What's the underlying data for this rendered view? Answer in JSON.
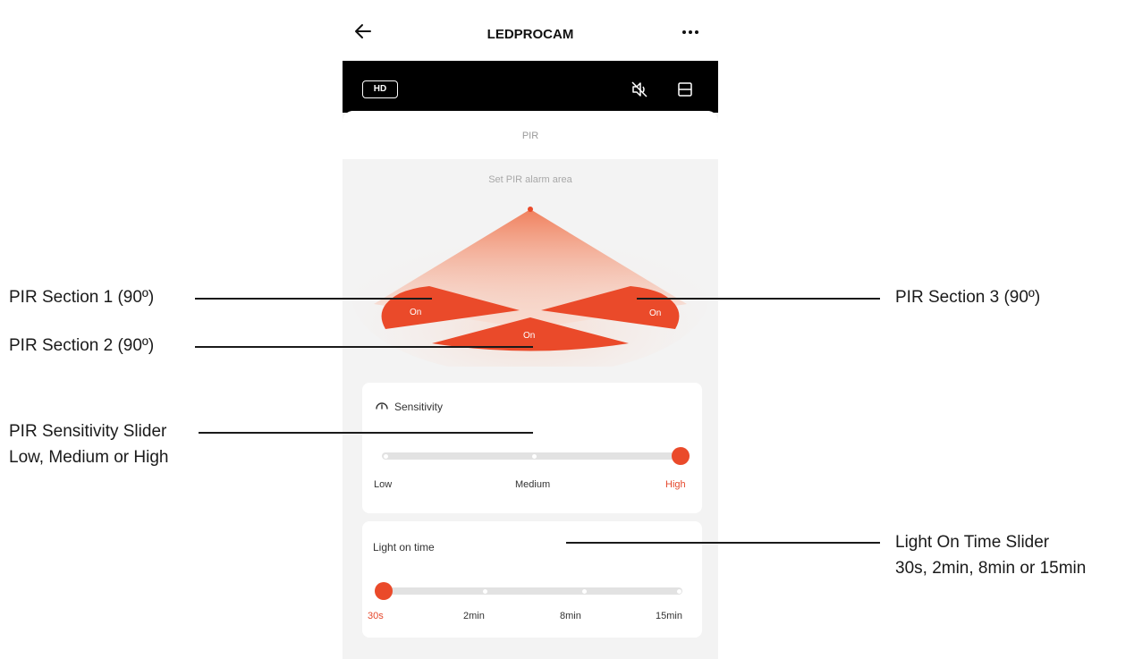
{
  "app": {
    "title": "LEDPROCAM",
    "hd_label": "HD"
  },
  "panel": {
    "title": "PIR",
    "subtitle": "Set PIR alarm area"
  },
  "pir_sections": [
    {
      "label": "On",
      "state": "on"
    },
    {
      "label": "On",
      "state": "on"
    },
    {
      "label": "On",
      "state": "on"
    }
  ],
  "sensitivity": {
    "title": "Sensitivity",
    "options": [
      "Low",
      "Medium",
      "High"
    ],
    "selected": "High"
  },
  "light_on_time": {
    "title": "Light on time",
    "options": [
      "30s",
      "2min",
      "8min",
      "15min"
    ],
    "selected": "30s"
  },
  "callouts": {
    "pir1": "PIR Section 1 (90º)",
    "pir2": "PIR Section 2 (90º)",
    "pir3": "PIR Section 3 (90º)",
    "sens_line1": "PIR Sensitivity Slider",
    "sens_line2": "Low, Medium or High",
    "light_line1": "Light On Time Slider",
    "light_line2": "30s, 2min, 8min or 15min"
  },
  "colors": {
    "accent": "#ea4a2a",
    "accent_text": "#e5472b"
  },
  "icons": {
    "back": "back-arrow-icon",
    "more": "more-dots-icon",
    "mute": "speaker-muted-icon",
    "layout": "layout-icon",
    "sensitivity": "gauge-icon"
  }
}
